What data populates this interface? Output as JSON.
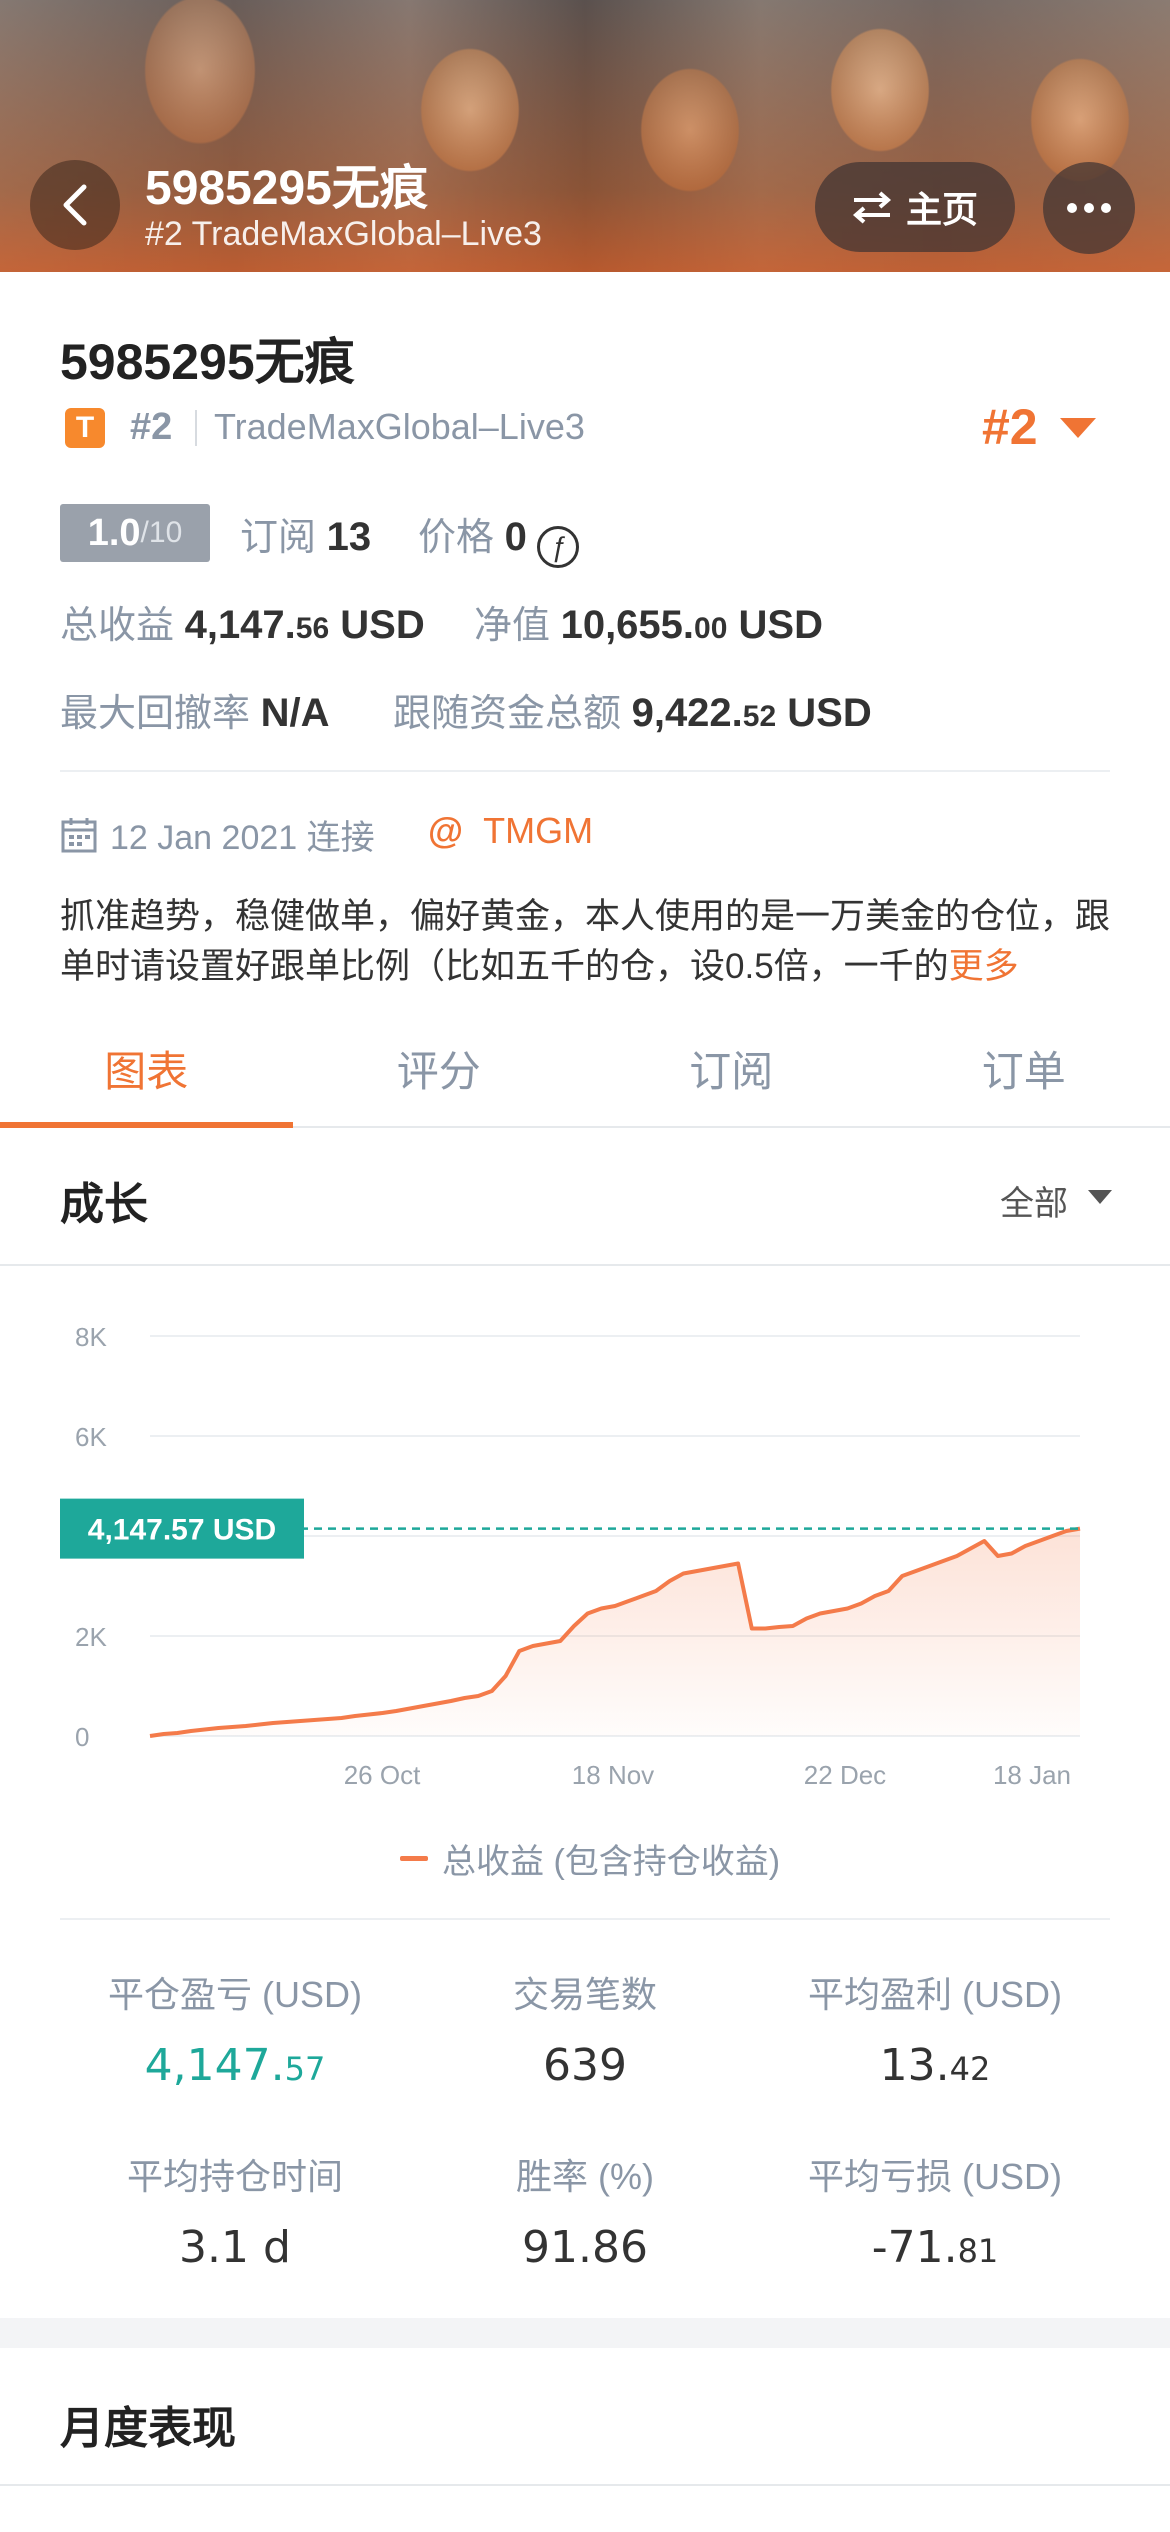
{
  "header": {
    "title": "5985295无痕",
    "subtitle": "#2 TradeMaxGlobal–Live3",
    "home_label": "主页"
  },
  "profile": {
    "name": "5985295无痕",
    "badge_letter": "T",
    "rank_small": "#2",
    "broker": "TradeMaxGlobal–Live3",
    "rank_big": "#2",
    "score_main": "1.0",
    "score_max": "/10",
    "subscribe_label": "订阅",
    "subscribe_value": "13",
    "price_label": "价格",
    "price_value": "0",
    "coin_symbol": "ƒ",
    "total_profit_label": "总收益",
    "total_profit_int": "4,147.",
    "total_profit_dec": "56",
    "total_profit_unit": "USD",
    "equity_label": "净值",
    "equity_int": "10,655.",
    "equity_dec": "00",
    "equity_unit": "USD",
    "drawdown_label": "最大回撤率",
    "drawdown_value": "N/A",
    "follow_label": "跟随资金总额",
    "follow_int": "9,422.",
    "follow_dec": "52",
    "follow_unit": "USD",
    "connected_text": "12 Jan 2021 连接",
    "broker_tag": "TMGM",
    "description": "抓准趋势，稳健做单，偏好黄金，本人使用的是一万美金的仓位，跟单时请设置好跟单比例（比如五千的仓，设0.5倍，一千的",
    "more_label": "更多"
  },
  "tabs": [
    "图表",
    "评分",
    "订阅",
    "订单"
  ],
  "active_tab": 0,
  "growth": {
    "title": "成长",
    "range_label": "全部"
  },
  "chart_data": {
    "type": "area",
    "ylim": [
      0,
      8000
    ],
    "y_ticks": [
      "0",
      "2K",
      "4K",
      "6K",
      "8K"
    ],
    "x_ticks": [
      "26 Oct",
      "18 Nov",
      "22 Dec",
      "18 Jan"
    ],
    "current_label": "4,147.57 USD",
    "current_value": 4147.57,
    "series": [
      {
        "name": "总收益 (包含持仓收益)",
        "color": "#f47b4a",
        "values": [
          0,
          40,
          60,
          100,
          130,
          160,
          180,
          200,
          230,
          260,
          280,
          300,
          320,
          340,
          360,
          400,
          430,
          460,
          500,
          550,
          600,
          650,
          700,
          760,
          800,
          900,
          1200,
          1700,
          1800,
          1850,
          1900,
          2200,
          2450,
          2550,
          2600,
          2700,
          2800,
          2900,
          3100,
          3250,
          3300,
          3350,
          3400,
          3450,
          2150,
          2150,
          2180,
          2200,
          2350,
          2450,
          2500,
          2550,
          2650,
          2800,
          2900,
          3200,
          3300,
          3400,
          3500,
          3600,
          3750,
          3900,
          3600,
          3650,
          3800,
          3900,
          4000,
          4100,
          4147.57
        ]
      }
    ]
  },
  "legend_label": "总收益 (包含持仓收益)",
  "stats": [
    {
      "label": "平仓盈亏 (USD)",
      "int": "4,147.",
      "dec": "57",
      "green": true
    },
    {
      "label": "交易笔数",
      "int": "639",
      "dec": "",
      "green": false
    },
    {
      "label": "平均盈利 (USD)",
      "int": "13.",
      "dec": "42",
      "green": false
    },
    {
      "label": "平均持仓时间",
      "int": "3.1 d",
      "dec": "",
      "green": false
    },
    {
      "label": "胜率 (%)",
      "int": "91.86",
      "dec": "",
      "green": false
    },
    {
      "label": "平均亏损 (USD)",
      "int": "-71.",
      "dec": "81",
      "green": false
    }
  ],
  "monthly_title": "月度表现",
  "colors": {
    "accent": "#f07434",
    "green": "#1ea89a",
    "muted": "#8a96a6"
  }
}
